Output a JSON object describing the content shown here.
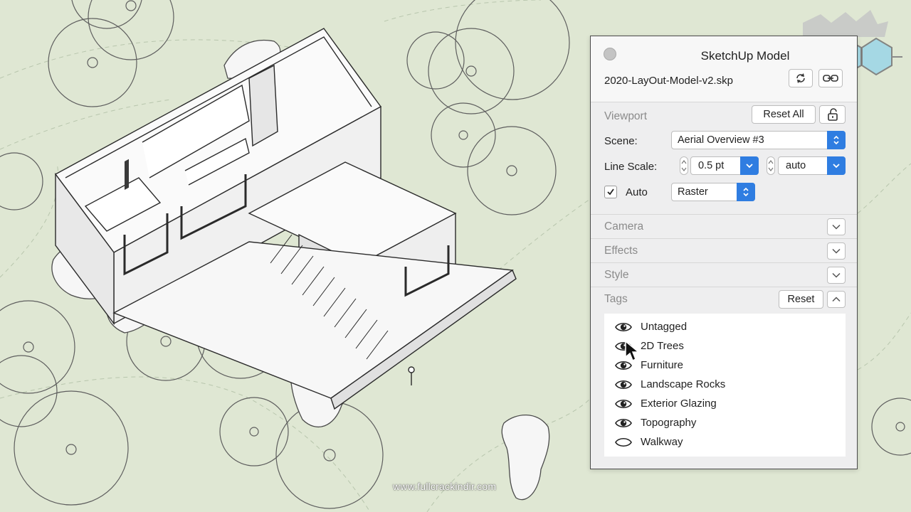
{
  "panel": {
    "title": "SketchUp Model",
    "file_name": "2020-LayOut-Model-v2.skp",
    "viewport": {
      "section_label": "Viewport",
      "reset_all_label": "Reset All",
      "scene_label": "Scene:",
      "scene_value": "Aerial Overview #3",
      "line_scale_label": "Line Scale:",
      "line_scale_value": "0.5 pt",
      "line_scale_mode": "auto",
      "auto_label": "Auto",
      "auto_checked": true,
      "render_mode": "Raster"
    },
    "sections": {
      "camera": "Camera",
      "effects": "Effects",
      "style": "Style",
      "tags": "Tags",
      "tags_reset_label": "Reset"
    },
    "tags": [
      {
        "label": "Untagged",
        "visible": true
      },
      {
        "label": "2D Trees",
        "visible": true
      },
      {
        "label": "Furniture",
        "visible": true
      },
      {
        "label": "Landscape Rocks",
        "visible": true
      },
      {
        "label": "Exterior Glazing",
        "visible": true
      },
      {
        "label": "Topography",
        "visible": true
      },
      {
        "label": "Walkway",
        "visible": false
      }
    ]
  },
  "watermark": "www.fullcrackindir.com",
  "colors": {
    "accent": "#2f7de1",
    "ground": "#dfe7d3",
    "panel_bg": "#eeeeef"
  }
}
